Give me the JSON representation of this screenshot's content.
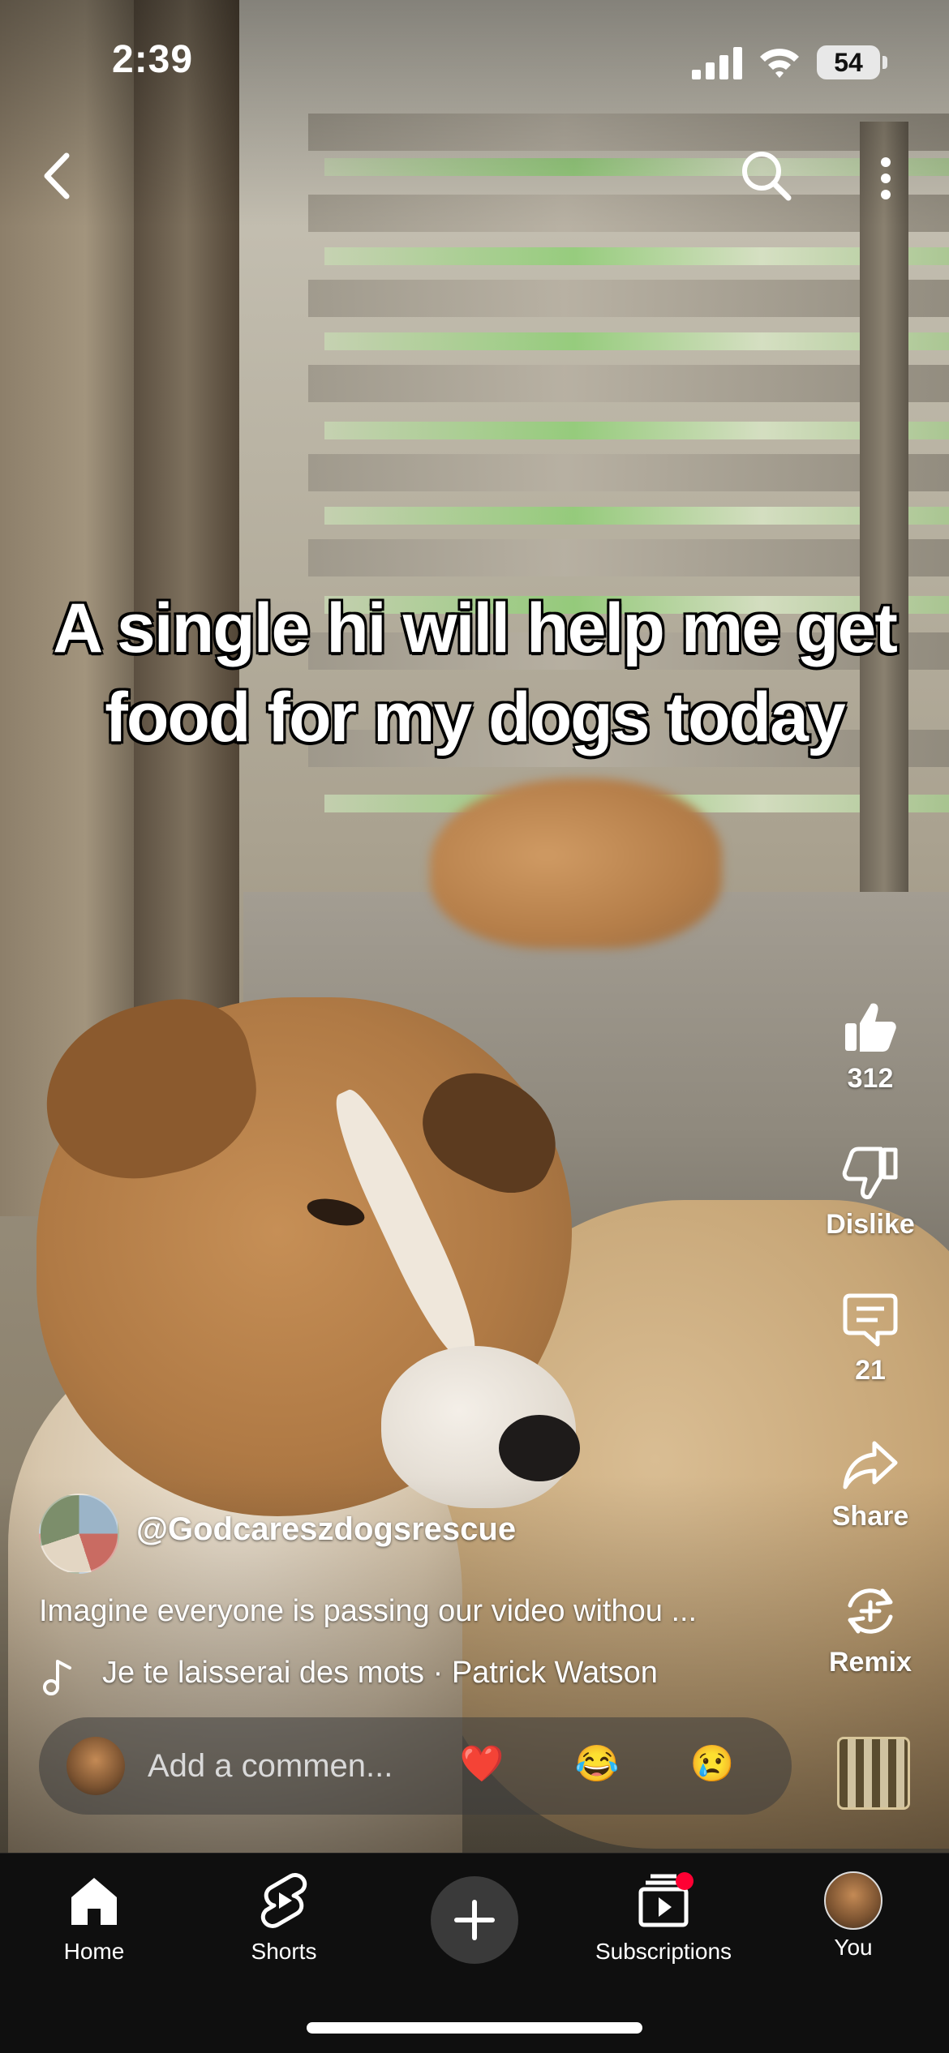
{
  "status_bar": {
    "time": "2:39",
    "battery": "54"
  },
  "video": {
    "caption_line1": "A single hi will help me get",
    "caption_line2": "food for my dogs today"
  },
  "actions": {
    "like_count": "312",
    "dislike_label": "Dislike",
    "comments_count": "21",
    "share_label": "Share",
    "remix_label": "Remix"
  },
  "channel": {
    "handle": "@Godcareszdogsrescue",
    "description": "Imagine everyone is passing our video withou ...",
    "music": "Je te laisserai des mots · Patrick Watson"
  },
  "comment_bar": {
    "placeholder": "Add a commen...",
    "emojis": [
      "❤️",
      "😂",
      "😢"
    ]
  },
  "bottom_nav": {
    "items": [
      {
        "label": "Home",
        "icon": "home-icon"
      },
      {
        "label": "Shorts",
        "icon": "shorts-icon"
      },
      {
        "label": "",
        "icon": "create-icon"
      },
      {
        "label": "Subscriptions",
        "icon": "subscriptions-icon"
      },
      {
        "label": "You",
        "icon": "avatar"
      }
    ]
  },
  "colors": {
    "notification_dot": "#ff0033",
    "nav_background": "#0f0f0f"
  }
}
